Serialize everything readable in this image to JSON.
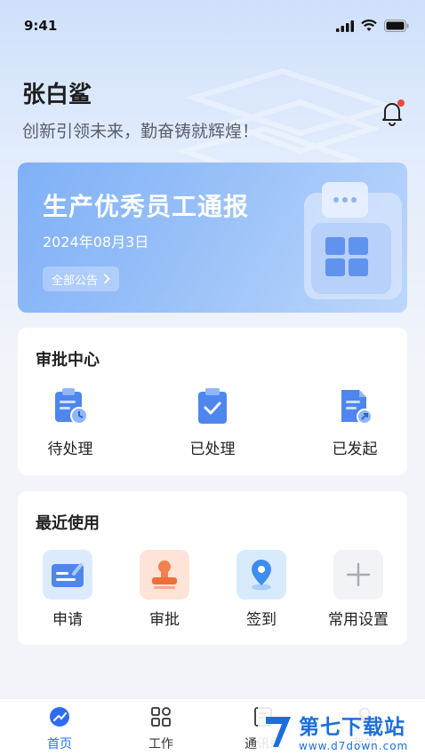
{
  "status": {
    "time": "9:41"
  },
  "header": {
    "username": "张白鲨",
    "slogan": "创新引领未来，勤奋铸就辉煌！"
  },
  "banner": {
    "title": "生产优秀员工通报",
    "date": "2024年08月3日",
    "button": "全部公告"
  },
  "approval": {
    "title": "审批中心",
    "items": [
      {
        "label": "待处理",
        "icon": "pending-clipboard-icon"
      },
      {
        "label": "已处理",
        "icon": "processed-clipboard-icon"
      },
      {
        "label": "已发起",
        "icon": "initiated-document-icon"
      }
    ]
  },
  "recent": {
    "title": "最近使用",
    "items": [
      {
        "label": "申请",
        "icon": "apply-card-icon"
      },
      {
        "label": "审批",
        "icon": "stamp-icon"
      },
      {
        "label": "签到",
        "icon": "location-pin-icon"
      },
      {
        "label": "常用设置",
        "icon": "plus-icon"
      }
    ]
  },
  "tabs": [
    {
      "label": "首页",
      "icon": "home-icon",
      "active": true
    },
    {
      "label": "工作",
      "icon": "grid-icon"
    },
    {
      "label": "通讯录",
      "icon": "contacts-icon"
    },
    {
      "label": "我的",
      "icon": "profile-icon"
    }
  ],
  "watermark": {
    "title": "第七下载站",
    "url": "www.d7down.com"
  },
  "colors": {
    "accent": "#2f6df0",
    "banner": "#8fb9f7",
    "background": "#f2f4f9"
  }
}
